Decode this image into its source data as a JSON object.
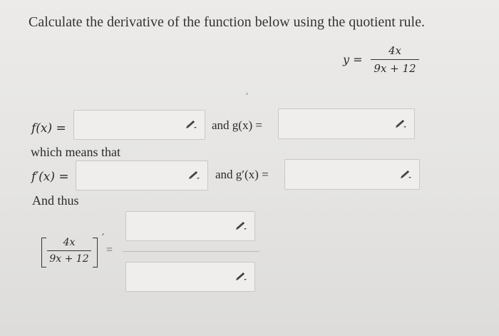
{
  "instruction": "Calculate the derivative of the function below using the quotient rule.",
  "equation": {
    "lhs": "y =",
    "numerator": "4x",
    "denominator": "9x + 12"
  },
  "row1": {
    "f_label": "f(x) =",
    "and_g_label": "and g(x) ="
  },
  "which_means_that": "which means that",
  "row2": {
    "fprime_label": "f′(x) =",
    "and_gprime_label": "and g′(x) ="
  },
  "and_thus": "And thus",
  "derivative": {
    "numerator": "4x",
    "denominator": "9x + 12",
    "prime": "′",
    "equals": "="
  },
  "icons": {
    "edit": "pencil-icon"
  },
  "colors": {
    "background": "#e6e5e3",
    "box_border": "#c9c8c6",
    "text": "#2a2a2a"
  }
}
